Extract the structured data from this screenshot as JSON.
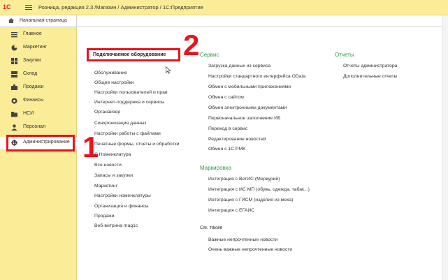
{
  "window": {
    "logo": "1С",
    "title": "Розница, редакция 2.3 /Магазин / Администратор / 1С:Предприятие"
  },
  "home_tab": {
    "label": "Начальная страница"
  },
  "sidebar": {
    "items": [
      {
        "label": "Главное",
        "icon": "list-icon"
      },
      {
        "label": "Маркетинг",
        "icon": "pie-chart-icon"
      },
      {
        "label": "Закупки",
        "icon": "grid-icon"
      },
      {
        "label": "Склад",
        "icon": "boxes-icon"
      },
      {
        "label": "Продажи",
        "icon": "cart-icon"
      },
      {
        "label": "Финансы",
        "icon": "coins-icon"
      },
      {
        "label": "НСИ",
        "icon": "folder-icon"
      },
      {
        "label": "Персонал",
        "icon": "person-icon"
      },
      {
        "label": "Администрирование",
        "icon": "gear-icon"
      }
    ]
  },
  "annotations": {
    "step1": "1",
    "step2": "2",
    "accent": "#e8141c"
  },
  "left_column": {
    "highlighted": "Подключаемое оборудование",
    "items": [
      "Обслуживание",
      "Общие настройки",
      "Настройки пользователей и прав",
      "Интернет-поддержка и сервисы",
      "Органайзер",
      "Синхронизация данных",
      "Настройки работы с файлами",
      "Печатные формы, отчеты и обработки",
      "С Номенклатура",
      "Все новости",
      "Запасы и закупки",
      "Маркетинг",
      "Настройки номенклатуры",
      "Организация и финансы",
      "Продажи",
      "Веб-витрина mag1c"
    ]
  },
  "service": {
    "header": "Сервис",
    "items": [
      "Загрузка данных из сервиса",
      "Настройки стандартного интерфейса OData",
      "Обмен с мобильными приложениями",
      "Обмен с сайтом",
      "Обмен электронными документами",
      "Первоначальное заполнение ИБ",
      "Переход в сервис",
      "Редактирование новостей",
      "Обмен с 1С:РМК"
    ]
  },
  "marking": {
    "header": "Маркировка",
    "items": [
      "Интеграция с ВетИС (Меркурий)",
      "Интеграция с ИС МП (обувь, одежда, табак...)",
      "Интеграция с ГИСМ (изделия из меха)",
      "Интеграция с ЕГАИС"
    ]
  },
  "see_also": {
    "header": "См. также",
    "items": [
      "Важные непрочтенные новости",
      "Очень важные непрочтенные новости"
    ]
  },
  "reports": {
    "header": "Отчеты",
    "items": [
      "Отчеты администратора",
      "Дополнительные отчеты"
    ]
  }
}
